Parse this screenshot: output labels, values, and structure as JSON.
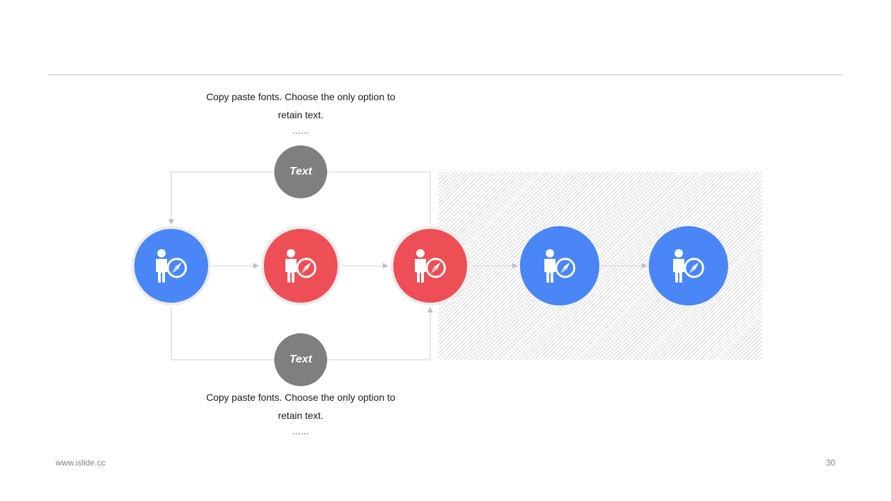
{
  "top_text": {
    "label": "Text",
    "caption_line1": "Copy paste fonts. Choose the only option to",
    "caption_line2": "retain text.",
    "caption_dots": "……"
  },
  "bottom_text": {
    "label": "Text",
    "caption_line1": "Copy paste fonts. Choose the only option to",
    "caption_line2": "retain text.",
    "caption_dots": "……"
  },
  "nodes": [
    {
      "color": "blue",
      "icon": "person-compass-icon"
    },
    {
      "color": "red",
      "icon": "person-compass-icon"
    },
    {
      "color": "red",
      "icon": "person-compass-icon"
    },
    {
      "color": "blue",
      "icon": "person-compass-icon"
    },
    {
      "color": "blue",
      "icon": "person-compass-icon"
    }
  ],
  "colors": {
    "blue": "#4a86f6",
    "red": "#ee4e55",
    "gray": "#7f7f7f"
  },
  "footer": {
    "website": "www.islide.cc",
    "page_number": "30"
  }
}
